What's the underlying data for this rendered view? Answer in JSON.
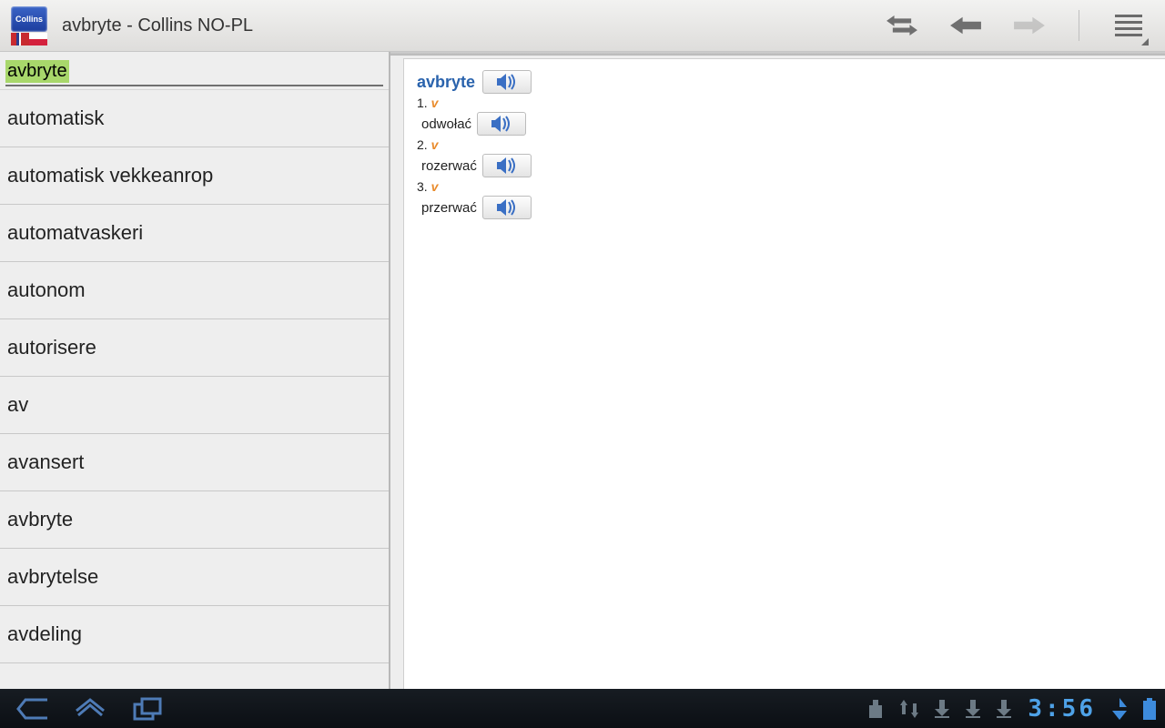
{
  "app_icon_label": "Collins",
  "title": "avbryte - Collins NO-PL",
  "search_value": "avbryte",
  "wordlist": [
    "automatisk",
    "automatisk vekkeanrop",
    "automatvaskeri",
    "autonom",
    "autorisere",
    "av",
    "avansert",
    "avbryte",
    "avbrytelse",
    "avdeling"
  ],
  "entry": {
    "headword": "avbryte",
    "senses": [
      {
        "num": "1.",
        "pos": "v",
        "translation": "odwołać"
      },
      {
        "num": "2.",
        "pos": "v",
        "translation": "rozerwać"
      },
      {
        "num": "3.",
        "pos": "v",
        "translation": "przerwać"
      }
    ]
  },
  "clock": "3:56",
  "nav_back_disabled": false,
  "nav_forward_disabled": true
}
